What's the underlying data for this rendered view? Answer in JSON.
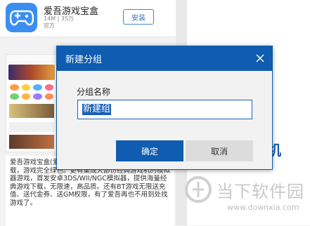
{
  "app": {
    "name": "爱吾游戏宝盒",
    "size": "14M | 35万",
    "source": "官方",
    "install_label": "安装"
  },
  "description": {
    "text": "爱吾游戏宝盒(爱吾游戏盒)... 游戏发布平台，全... 载，游戏完全绿色。更有集成大部份经典游戏机的模拟器游戏，首发安卓3DS/WII/NGC模拟器，提供海量经典游戏下载，无限速，高品质。还有BT游戏无限送充值、送代金券、送GM权限，有了爱吾再也不用到处找游戏了。"
  },
  "background": {
    "title_fragment": "机",
    "watermark_text": "当下软件园",
    "watermark_url": "www.downxia.com"
  },
  "dialog": {
    "title": "新建分组",
    "field_label": "分组名称",
    "input_value": "新建组",
    "ok_label": "确定",
    "cancel_label": "取消"
  },
  "colors": {
    "accent": "#0f5cb0",
    "app_icon": "#3a8ef2"
  }
}
